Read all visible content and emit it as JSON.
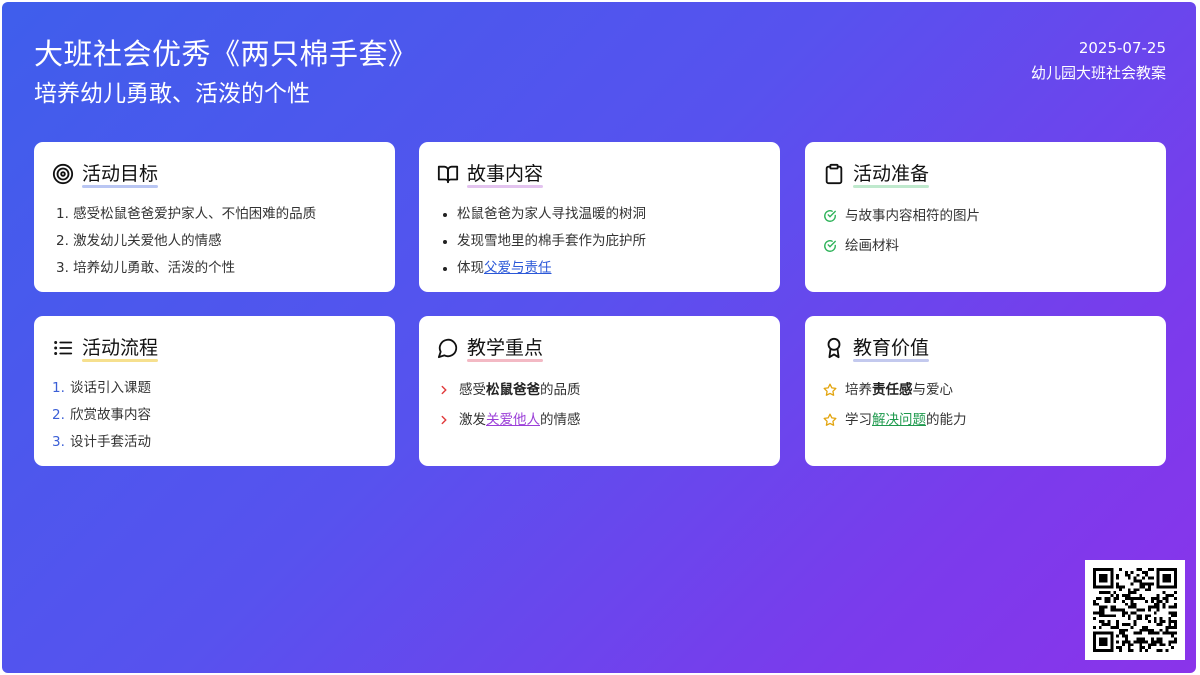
{
  "header": {
    "title": "大班社会优秀《两只棉手套》",
    "subtitle": "培养幼儿勇敢、活泼的个性",
    "date": "2025-07-25",
    "category": "幼儿园大班社会教案"
  },
  "cards": {
    "goals": {
      "title": "活动目标",
      "icon": "target-icon",
      "underline": "#b9c6f3",
      "items": [
        "1. 感受松鼠爸爸爱护家人、不怕困难的品质",
        "2. 激发幼儿关爱他人的情感",
        "3. 培养幼儿勇敢、活泼的个性"
      ]
    },
    "story": {
      "title": "故事内容",
      "icon": "book-icon",
      "underline": "#e3c3ef",
      "items": [
        "松鼠爸爸为家人寻找温暖的树洞",
        "发现雪地里的棉手套作为庇护所"
      ],
      "item3_prefix": "体现",
      "item3_link": "父爱与责任"
    },
    "prep": {
      "title": "活动准备",
      "icon": "clipboard-icon",
      "underline": "#bfe9cd",
      "items": [
        "与故事内容相符的图片",
        "绘画材料"
      ]
    },
    "flow": {
      "title": "活动流程",
      "icon": "list-icon",
      "underline": "#f6e08e",
      "items": [
        {
          "num": "1.",
          "text": "谈话引入课题"
        },
        {
          "num": "2.",
          "text": "欣赏故事内容"
        },
        {
          "num": "3.",
          "text": "设计手套活动"
        }
      ]
    },
    "focus": {
      "title": "教学重点",
      "icon": "speech-bubble-icon",
      "underline": "#f3b9c4",
      "item1_prefix": "感受",
      "item1_bold": "松鼠爸爸",
      "item1_suffix": "的品质",
      "item2_prefix": "激发",
      "item2_link": "关爱他人",
      "item2_suffix": "的情感"
    },
    "value": {
      "title": "教育价值",
      "icon": "award-icon",
      "underline": "#c3c9ee",
      "item1_prefix": "培养",
      "item1_bold": "责任感",
      "item1_suffix": "与爱心",
      "item2_prefix": "学习",
      "item2_link": "解决问题",
      "item2_suffix": "的能力"
    }
  },
  "colors": {
    "gradient_start": "#3f5eec",
    "gradient_end": "#8a34ea",
    "check": "#2fb35a",
    "chevron": "#e0393b",
    "star": "#e3a50f",
    "number": "#3b5fd6"
  },
  "qr_code": "qr-code-icon"
}
